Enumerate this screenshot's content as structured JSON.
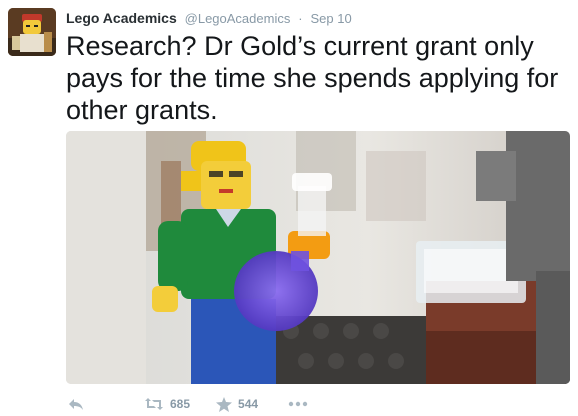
{
  "tweet": {
    "display_name": "Lego Academics",
    "handle": "@LegoAcademics",
    "separator": "·",
    "date": "Sep 10",
    "text": "Research? Dr Gold’s current grant only pays for the time she spends applying for other grants."
  },
  "actions": {
    "retweets": "685",
    "favorites": "544",
    "icons": [
      "reply-icon",
      "retweet-icon",
      "star-icon",
      "more-icon"
    ]
  },
  "colors": {
    "name": "#292f33",
    "meta": "#8899a6",
    "text": "#14171a",
    "action_icon": "#aab8c2"
  }
}
